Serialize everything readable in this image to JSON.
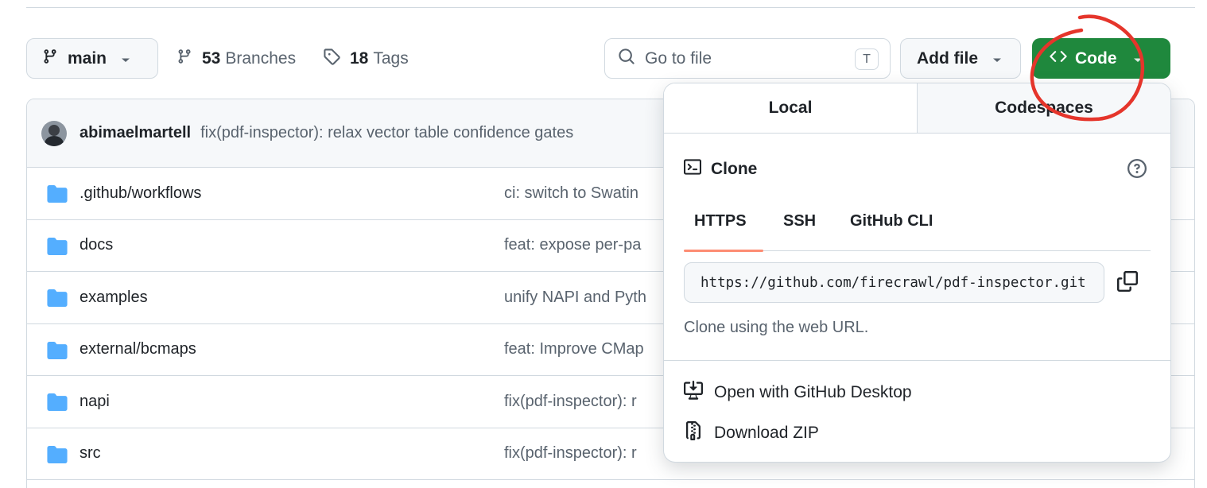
{
  "toolbar": {
    "branch_name": "main",
    "branches_count": "53",
    "branches_label": "Branches",
    "tags_count": "18",
    "tags_label": "Tags",
    "go_to_file_placeholder": "Go to file",
    "go_to_file_shortcut": "T",
    "add_file_label": "Add file",
    "code_label": "Code"
  },
  "commit": {
    "author": "abimaelmartell",
    "message": "fix(pdf-inspector): relax vector table confidence gates"
  },
  "files": [
    {
      "name": ".github/workflows",
      "message": "ci: switch to Swatin"
    },
    {
      "name": "docs",
      "message": "feat: expose per-pa"
    },
    {
      "name": "examples",
      "message": "unify NAPI and Pyth"
    },
    {
      "name": "external/bcmaps",
      "message": "feat: Improve CMap"
    },
    {
      "name": "napi",
      "message": "fix(pdf-inspector): r"
    },
    {
      "name": "src",
      "message": "fix(pdf-inspector): r"
    }
  ],
  "dropdown": {
    "tabs": [
      "Local",
      "Codespaces"
    ],
    "clone_title": "Clone",
    "protocols": [
      "HTTPS",
      "SSH",
      "GitHub CLI"
    ],
    "active_protocol": "HTTPS",
    "clone_url": "https://github.com/firecrawl/pdf-inspector.git",
    "hint": "Clone using the web URL.",
    "open_desktop_label": "Open with GitHub Desktop",
    "download_zip_label": "Download ZIP"
  },
  "colors": {
    "code_button": "#1f883d",
    "folder_icon": "#54aeff",
    "tab_underline": "#fd8c73",
    "annotation": "#e5352b"
  }
}
